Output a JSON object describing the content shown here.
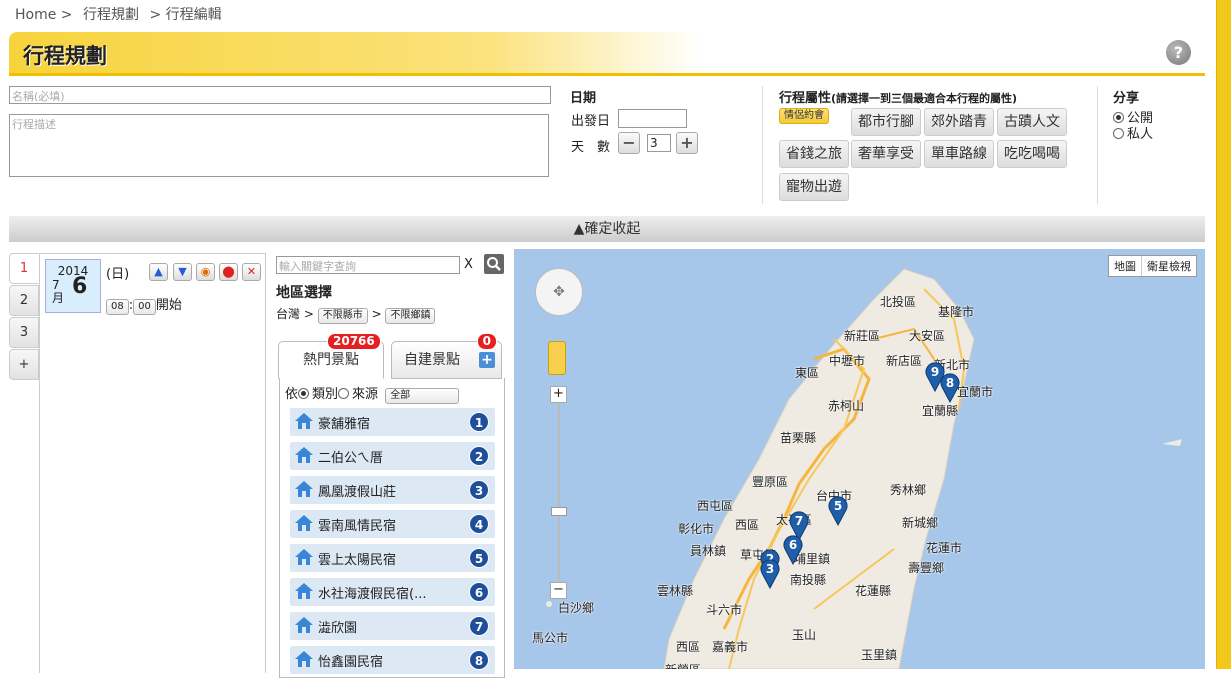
{
  "breadcrumb": {
    "home": "Home >",
    "plan": "行程規劃",
    "edit": "> 行程編輯"
  },
  "page_title": "行程規劃",
  "help_icon": "?",
  "form": {
    "name_placeholder": "名稱(必填)",
    "desc_placeholder": "行程描述",
    "date_heading": "日期",
    "depart_label": "出發日",
    "depart_value": "",
    "days_label": "天　數",
    "days_value": "3",
    "minus": "−",
    "plus": "+"
  },
  "attributes": {
    "heading": "行程屬性",
    "hint": "(請選擇一到三個最適合本行程的屬性)",
    "tags": [
      "情侶約會",
      "都市行腳",
      "郊外踏青",
      "古蹟人文",
      "省錢之旅",
      "奢華享受",
      "單車路線",
      "吃吃喝喝",
      "寵物出遊"
    ],
    "selected": "情侶約會"
  },
  "share": {
    "heading": "分享",
    "public": "公開",
    "private": "私人",
    "selected": "公開"
  },
  "collapse_label": "▲確定收起",
  "day_tabs": [
    "1",
    "2",
    "3",
    "+"
  ],
  "day": {
    "year": "2014",
    "month": "7",
    "month_unit": "月",
    "date": "6",
    "weekday": "(日)",
    "hour": "08",
    "minute": "00",
    "start_label": "開始",
    "colon": ":"
  },
  "search": {
    "placeholder": "輸入關鍵字查詢",
    "clear": "X",
    "region_heading": "地區選擇",
    "country": "台灣",
    "arrow": ">",
    "county": "不限縣市",
    "town": "不限鄉鎮"
  },
  "tabs": {
    "popular": {
      "label": "熱門景點",
      "count": "20766"
    },
    "custom": {
      "label": "自建景點",
      "count": "0"
    }
  },
  "filter": {
    "by": "依",
    "category": "類別",
    "source": "來源",
    "selected": "類別",
    "dropdown": "全部"
  },
  "spots": [
    {
      "name": "豪舖雅宿",
      "num": "1"
    },
    {
      "name": "二伯公ㄟ厝",
      "num": "2"
    },
    {
      "name": "鳳凰渡假山莊",
      "num": "3"
    },
    {
      "name": "雲南風情民宿",
      "num": "4"
    },
    {
      "name": "雲上太陽民宿",
      "num": "5"
    },
    {
      "name": "水社海渡假民宿(...",
      "num": "6"
    },
    {
      "name": "澁欣園",
      "num": "7"
    },
    {
      "name": "怡鑫園民宿",
      "num": "8"
    }
  ],
  "map": {
    "type_map": "地圖",
    "type_satellite": "衛星檢視",
    "zoom_in": "+",
    "zoom_out": "−",
    "places": [
      "北投區",
      "基隆市",
      "新莊區",
      "大安區",
      "中壢市",
      "新店區",
      "新北市",
      "東區",
      "宜蘭市",
      "赤柯山",
      "宜蘭縣",
      "苗栗縣",
      "豐原區",
      "台中市",
      "秀林鄉",
      "西屯區",
      "彰化市",
      "西區",
      "太平區",
      "新城鄉",
      "員林鎮",
      "草屯鎮",
      "埔里鎮",
      "花蓮市",
      "南投縣",
      "壽豐鄉",
      "雲林縣",
      "花蓮縣",
      "斗六市",
      "白沙鄉",
      "馬公市",
      "西區",
      "嘉義市",
      "玉山",
      "玉里鎮",
      "新營區"
    ],
    "markers": [
      "9",
      "8",
      "5",
      "7",
      "6",
      "2",
      "3"
    ]
  },
  "colors": {
    "accent": "#f2c81a",
    "marker": "#1f5faa",
    "list_bg": "#dce9f5",
    "badge": "#e52020"
  }
}
